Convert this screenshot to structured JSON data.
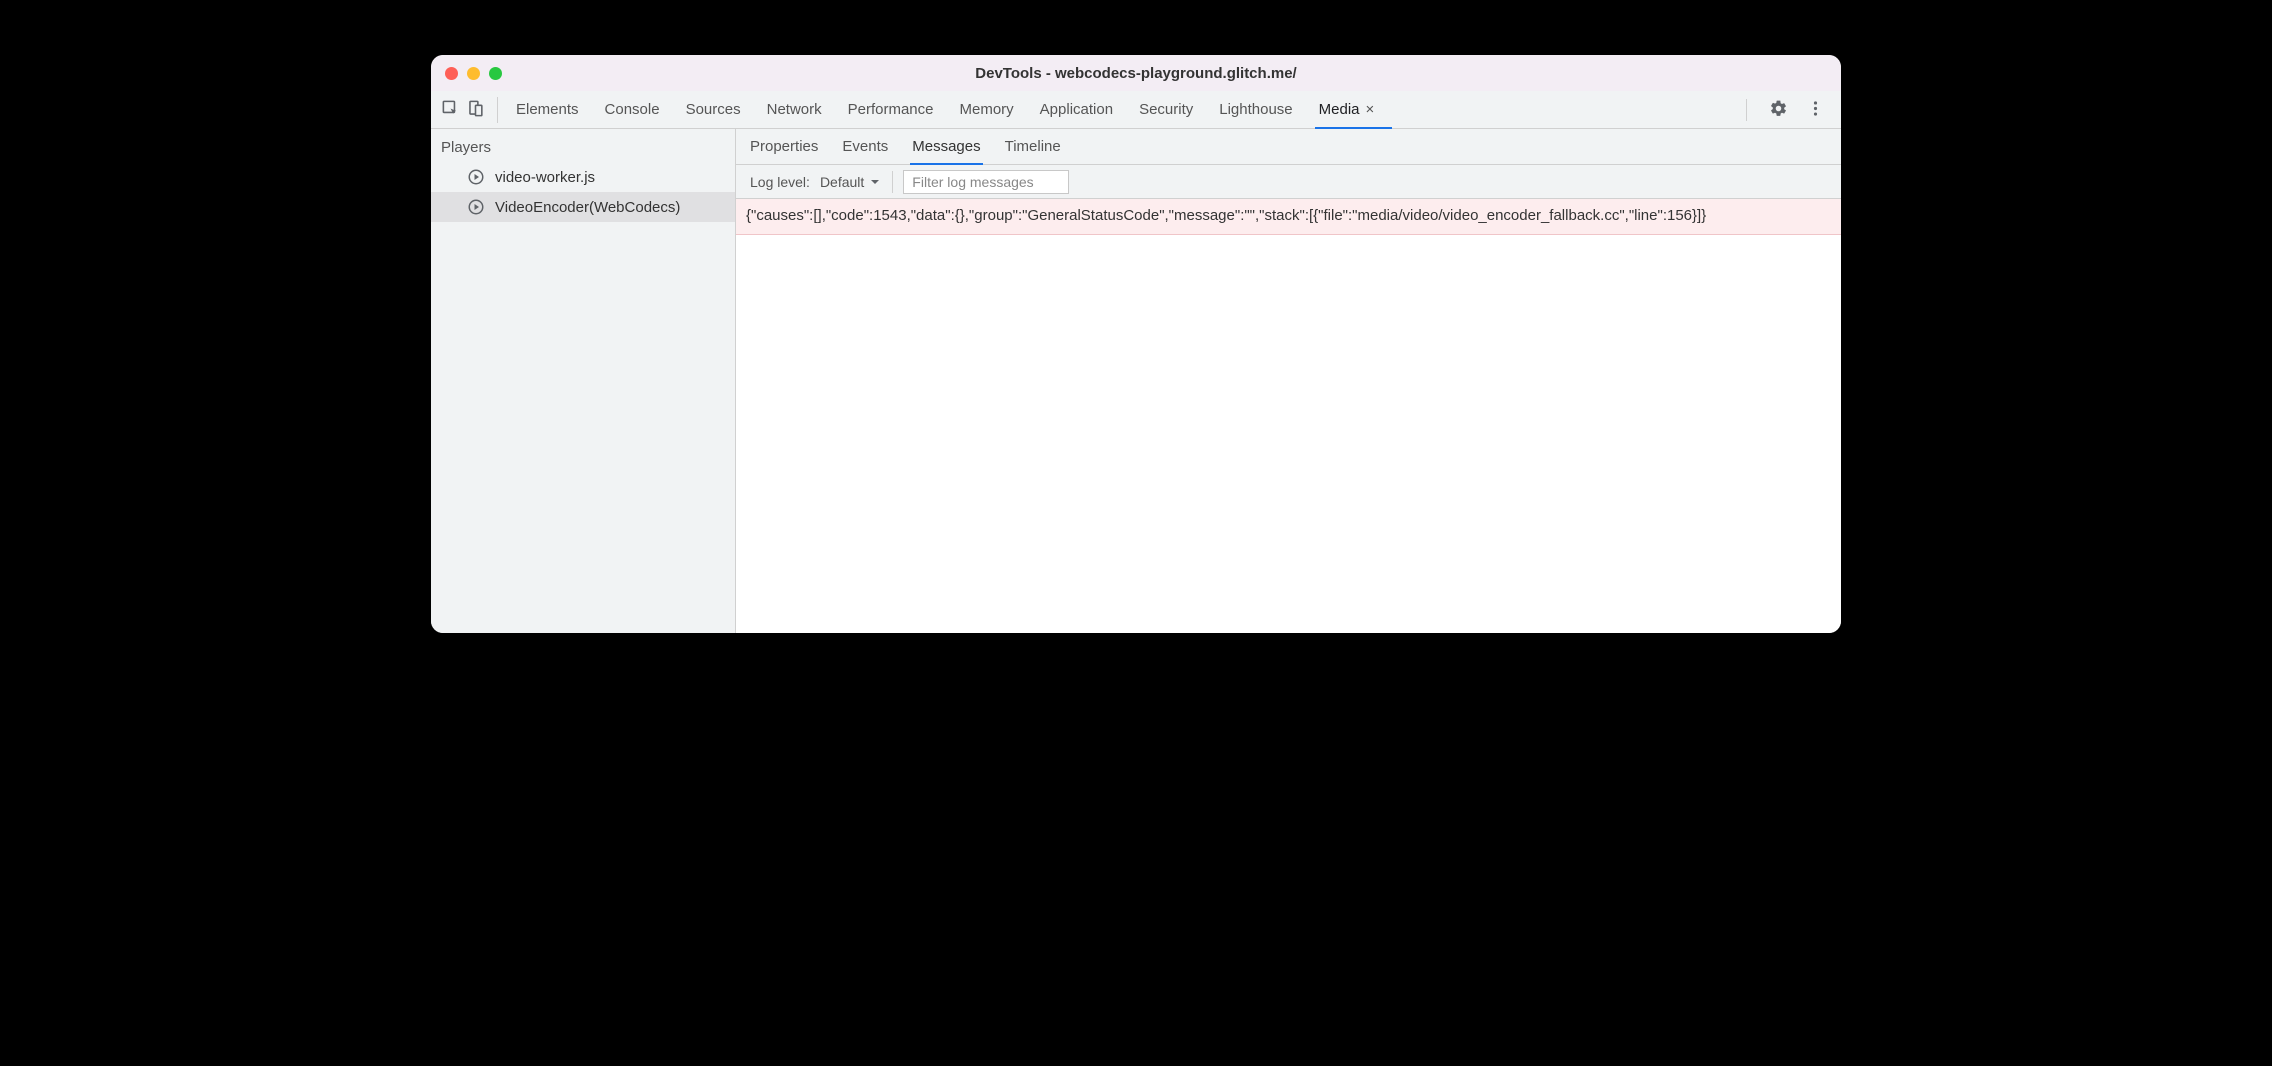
{
  "titlebar": {
    "title": "DevTools - webcodecs-playground.glitch.me/"
  },
  "main_tabs": {
    "items": [
      "Elements",
      "Console",
      "Sources",
      "Network",
      "Performance",
      "Memory",
      "Application",
      "Security",
      "Lighthouse",
      "Media"
    ],
    "active": "Media"
  },
  "sidebar": {
    "heading": "Players",
    "players": [
      {
        "label": "video-worker.js",
        "selected": false
      },
      {
        "label": "VideoEncoder(WebCodecs)",
        "selected": true
      }
    ]
  },
  "sub_tabs": {
    "items": [
      "Properties",
      "Events",
      "Messages",
      "Timeline"
    ],
    "active": "Messages"
  },
  "filter": {
    "log_level_label": "Log level:",
    "log_level_value": "Default",
    "placeholder": "Filter log messages"
  },
  "messages": [
    "{\"causes\":[],\"code\":1543,\"data\":{},\"group\":\"GeneralStatusCode\",\"message\":\"\",\"stack\":[{\"file\":\"media/video/video_encoder_fallback.cc\",\"line\":156}]}"
  ]
}
